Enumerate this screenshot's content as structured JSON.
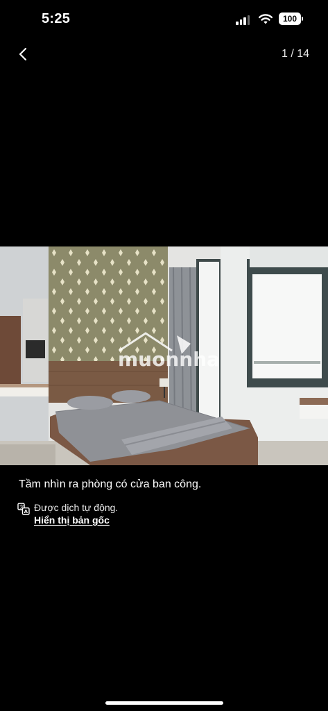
{
  "status_bar": {
    "time": "5:25",
    "battery": "100",
    "icons": [
      "signal-icon",
      "wifi-icon",
      "battery-icon"
    ]
  },
  "nav": {
    "back_icon": "chevron-left-icon",
    "counter": "1 / 14"
  },
  "photo": {
    "watermark": "muonnha"
  },
  "caption": "Tầm nhìn ra phòng có cửa ban công.",
  "translation": {
    "note": "Được dịch tự động.",
    "show_original": "Hiển thị bản gốc",
    "icon": "translate-icon"
  }
}
